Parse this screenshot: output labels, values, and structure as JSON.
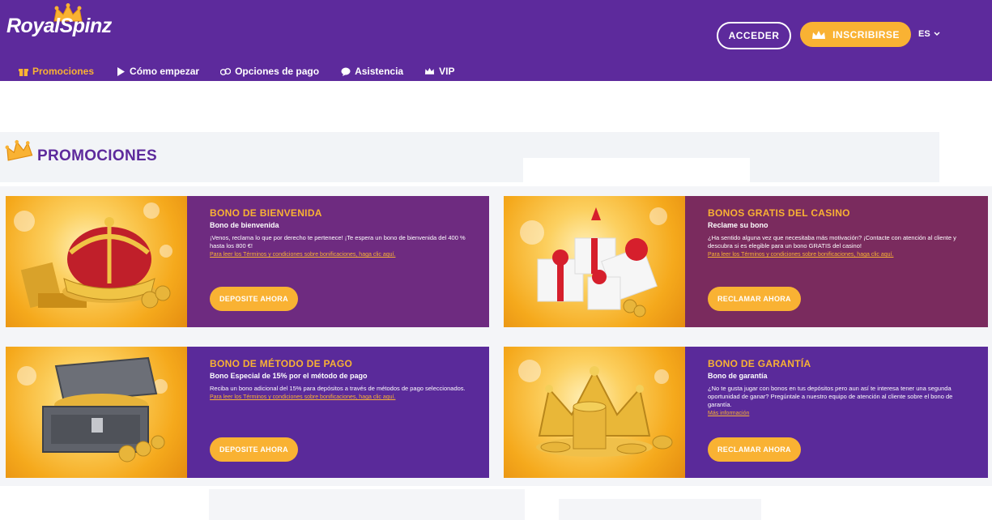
{
  "brand": {
    "logo_text": "RoyalSpinz"
  },
  "header": {
    "login_label": "ACCEDER",
    "signup_label": "INSCRIBIRSE",
    "language": "ES"
  },
  "nav": {
    "items": [
      {
        "label": "Promociones",
        "icon": "gift-icon",
        "active": true
      },
      {
        "label": "Cómo empezar",
        "icon": "play-icon",
        "active": false
      },
      {
        "label": "Opciones de pago",
        "icon": "coins-icon",
        "active": false
      },
      {
        "label": "Asistencia",
        "icon": "chat-icon",
        "active": false
      },
      {
        "label": "VIP",
        "icon": "crown-icon",
        "active": false
      }
    ]
  },
  "page": {
    "title": "PROMOCIONES"
  },
  "cards": [
    {
      "title": "BONO DE BIENVENIDA",
      "subtitle": "Bono de bienvenida",
      "text": "¡Venos, reclama lo que por derecho te pertenece! ¡Te espera un bono de bienvenida del 400 % hasta los 800 €!",
      "link": "Para leer los Términos y condiciones sobre bonificaciones, haga clic aquí.",
      "button": "DEPOSITE AHORA",
      "image": "crown-treasure-image"
    },
    {
      "title": "BONOS GRATIS DEL CASINO",
      "subtitle": "Reclame su bono",
      "text": "¿Ha sentido alguna vez que necesitaba más motivación? ¡Contacte con atención al cliente y descubra si es elegible para un bono GRATIS del casino!",
      "link": "Para leer los Términos y condiciones sobre bonificaciones, haga clic aquí.",
      "button": "RECLAMAR AHORA",
      "image": "gift-boxes-image"
    },
    {
      "title": "BONO DE MÉTODO DE PAGO",
      "subtitle": "Bono Especial de 15% por el método de pago",
      "text": "Reciba un bono adicional del 15% para depósitos a través de métodos de pago seleccionados.",
      "link": "Para leer los Términos y condiciones sobre bonificaciones, haga clic aquí.",
      "button": "DEPOSITE AHORA",
      "image": "treasure-chest-image"
    },
    {
      "title": "BONO DE GARANTÍA",
      "subtitle": "Bono de garantía",
      "text": "¿No te gusta jugar con bonos en tus depósitos pero aun así te interesa tener una segunda oportunidad de ganar? Pregúntale a nuestro equipo de atención al cliente sobre el bono de garantía.",
      "link": "Más información",
      "button": "RECLAMAR AHORA",
      "image": "gold-crown-coins-image"
    }
  ],
  "colors": {
    "header_bg": "#5d2a9c",
    "accent": "#f9b233",
    "card_purple": "#5a2a9a",
    "card_plum": "#7a2b5e"
  }
}
